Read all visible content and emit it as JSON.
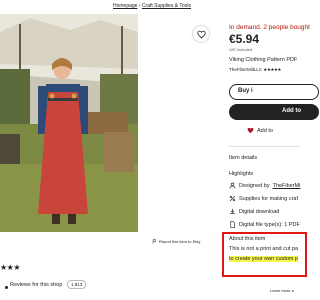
{
  "breadcrumb": {
    "home": "Homepage",
    "separator": "›",
    "category": "Craft Supplies & Tools"
  },
  "listing": {
    "demand": "In demand. 2 people bought",
    "price": "€5.94",
    "vat": "VAT included",
    "title": "Viking Clothing Pattern PDF",
    "shop_name": "TheFiberMillLLC",
    "shop_stars": "★★★★★"
  },
  "actions": {
    "buy_label": "Buy i",
    "add_label": "Add to",
    "add_collection_label": "Add to"
  },
  "details": {
    "heading": "Item details",
    "highlights_heading": "Highlights",
    "designed_by_prefix": "Designed by",
    "designed_by_shop": "TheFiberMi",
    "supplies": "Supplies for making craf",
    "digital_download": "Digital download",
    "file_types": "Digital file type(s): 1 PDF"
  },
  "report": {
    "label": "Report this item to Etsy"
  },
  "about": {
    "heading": "About this item",
    "line1": "This is not a print and cut pa",
    "line2": "to create your own custom p"
  },
  "learn_more": "Learn more a",
  "reviews": {
    "stars": "★★★",
    "label": "Reviews for this shop",
    "count": "1,813"
  },
  "icons": {
    "favorite": "heart-outline-icon",
    "collection": "heart-filled-icon",
    "designer": "user-icon",
    "supplies": "supplies-icon",
    "download": "download-icon",
    "file": "file-icon",
    "report": "flag-icon"
  },
  "colors": {
    "demand": "#b4160b",
    "highlight_box": "#e01717",
    "highlight_marker": "#f5f74a",
    "heart": "#a61a2e"
  }
}
